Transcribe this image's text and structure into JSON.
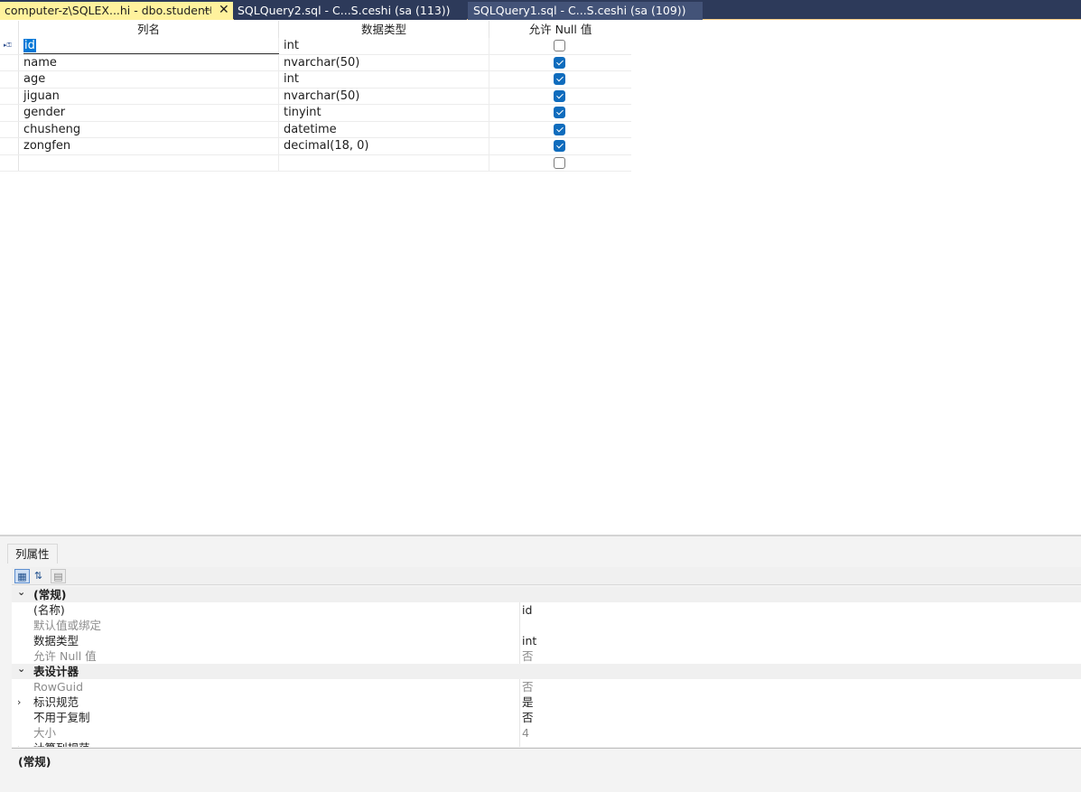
{
  "tabs": [
    {
      "label": "computer-z\\SQLEX...hi - dbo.student",
      "active": true
    },
    {
      "label": "SQLQuery2.sql - C...S.ceshi (sa (113))",
      "active": false
    },
    {
      "label": "SQLQuery1.sql - C...S.ceshi (sa (109))",
      "active": false
    }
  ],
  "icons": {
    "pin": "pin-icon",
    "close": "close-icon",
    "key": "primary-key-icon"
  },
  "grid": {
    "headers": {
      "name": "列名",
      "type": "数据类型",
      "null": "允许 Null 值"
    },
    "rows": [
      {
        "name": "id",
        "type": "int",
        "allow_null": false,
        "primary_key": true,
        "selected": true
      },
      {
        "name": "name",
        "type": "nvarchar(50)",
        "allow_null": true
      },
      {
        "name": "age",
        "type": "int",
        "allow_null": true
      },
      {
        "name": "jiguan",
        "type": "nvarchar(50)",
        "allow_null": true
      },
      {
        "name": "gender",
        "type": "tinyint",
        "allow_null": true
      },
      {
        "name": "chusheng",
        "type": "datetime",
        "allow_null": true
      },
      {
        "name": "zongfen",
        "type": "decimal(18, 0)",
        "allow_null": true
      },
      {
        "name": "",
        "type": "",
        "allow_null": false
      }
    ]
  },
  "properties": {
    "tab_label": "列属性",
    "rows": [
      {
        "kind": "category",
        "name": "(常规)",
        "expanded": true
      },
      {
        "kind": "prop",
        "name": "(名称)",
        "value": "id",
        "gray": false
      },
      {
        "kind": "prop",
        "name": "默认值或绑定",
        "value": "",
        "gray": true
      },
      {
        "kind": "prop",
        "name": "数据类型",
        "value": "int",
        "gray": false
      },
      {
        "kind": "prop",
        "name": "允许 Null 值",
        "value": "否",
        "gray": true
      },
      {
        "kind": "category",
        "name": "表设计器",
        "expanded": true
      },
      {
        "kind": "prop",
        "name": "RowGuid",
        "value": "否",
        "gray": true
      },
      {
        "kind": "prop",
        "name": "标识规范",
        "value": "是",
        "gray": false,
        "expandable": true
      },
      {
        "kind": "prop",
        "name": "不用于复制",
        "value": "否",
        "gray": false
      },
      {
        "kind": "prop",
        "name": "大小",
        "value": "4",
        "gray": true
      },
      {
        "kind": "prop",
        "name": "计算列规范",
        "value": "",
        "gray": false,
        "expandable": true
      }
    ],
    "description_title": "(常规)"
  },
  "colors": {
    "tab_bg": "#2d3a5a",
    "active_tab": "#fff29d",
    "checkbox_on": "#0f6cbd",
    "selection": "#0078d7"
  }
}
